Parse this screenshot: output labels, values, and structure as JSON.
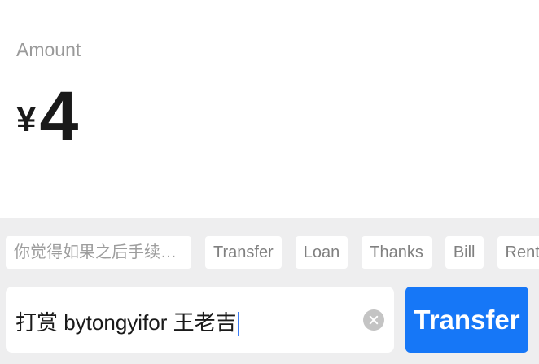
{
  "amount": {
    "label": "Amount",
    "currency_symbol": "¥",
    "value": "4"
  },
  "quick_phrases": [
    "你觉得如果之后手续…",
    "Transfer",
    "Loan",
    "Thanks",
    "Bill",
    "Rent"
  ],
  "input": {
    "value": "打赏 bytongyifor 王老吉"
  },
  "transfer_button": {
    "label": "Transfer",
    "color": "#1677f7"
  }
}
